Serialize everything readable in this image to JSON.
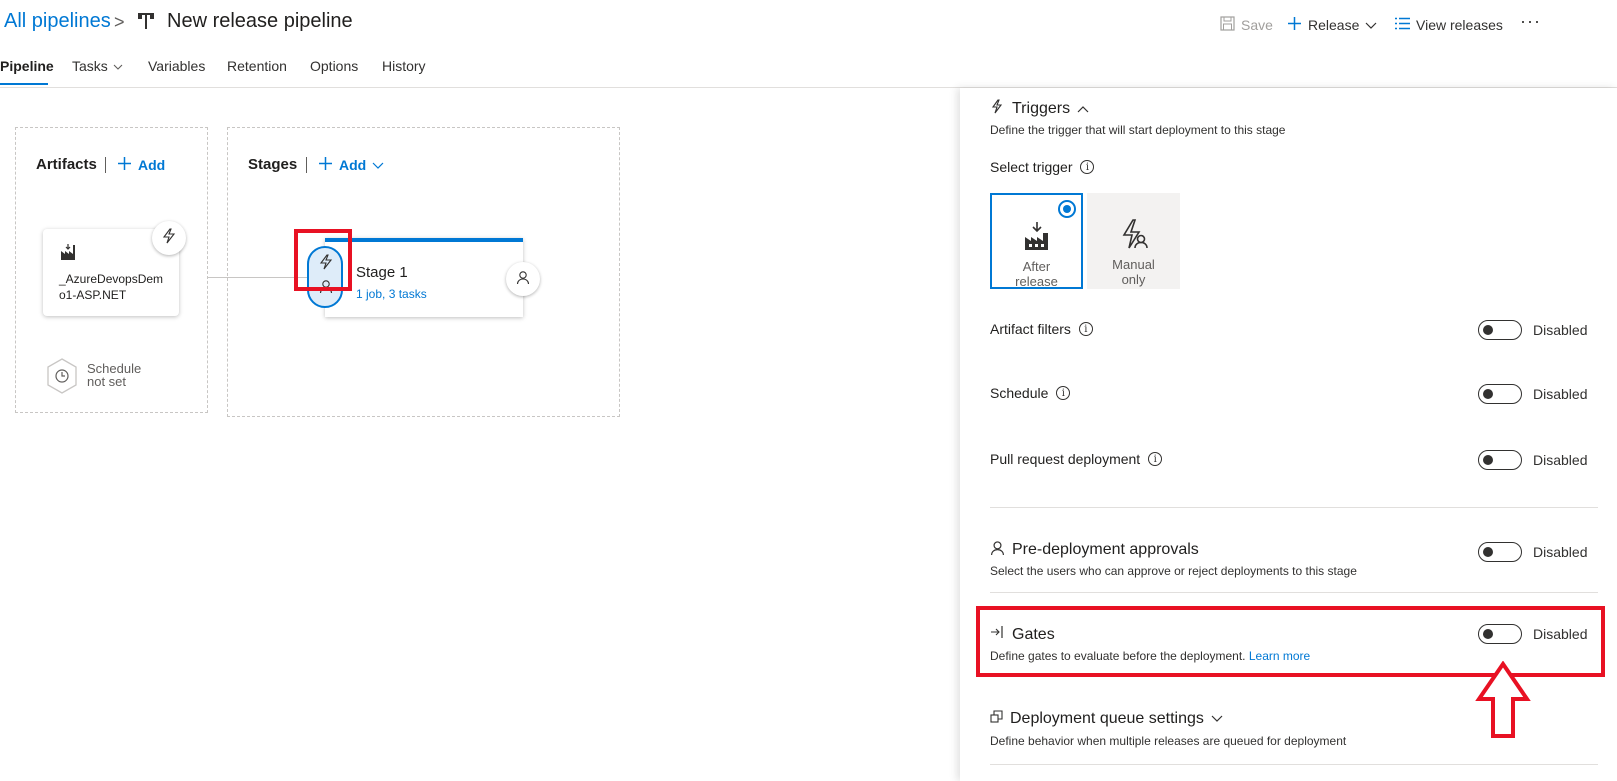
{
  "header": {
    "breadcrumb_link": "All pipelines",
    "breadcrumb_sep": ">",
    "title": "New release pipeline",
    "save_label": "Save",
    "release_label": "Release",
    "view_releases_label": "View releases",
    "more_label": "···"
  },
  "tabs": [
    {
      "label": "Pipeline",
      "active": true
    },
    {
      "label": "Tasks"
    },
    {
      "label": "Variables"
    },
    {
      "label": "Retention"
    },
    {
      "label": "Options"
    },
    {
      "label": "History"
    }
  ],
  "canvas": {
    "artifacts_title": "Artifacts",
    "artifacts_add": "Add",
    "artifact_name": "_AzureDevopsDemo1-ASP.NET",
    "schedule_line1": "Schedule",
    "schedule_line2": "not set",
    "stages_title": "Stages",
    "stages_add": "Add",
    "stage_name": "Stage 1",
    "stage_sub": "1 job, 3 tasks"
  },
  "panel": {
    "triggers_title": "Triggers",
    "triggers_desc": "Define the trigger that will start deployment to this stage",
    "select_trigger_label": "Select trigger",
    "after_release_line1": "After",
    "after_release_line2": "release",
    "manual_only_line1": "Manual",
    "manual_only_line2": "only",
    "rows": [
      {
        "label": "Artifact filters",
        "state": "Disabled"
      },
      {
        "label": "Schedule",
        "state": "Disabled"
      },
      {
        "label": "Pull request deployment",
        "state": "Disabled"
      }
    ],
    "approvals_title": "Pre-deployment approvals",
    "approvals_desc": "Select the users who can approve or reject deployments to this stage",
    "approvals_state": "Disabled",
    "gates_title": "Gates",
    "gates_desc": "Define gates to evaluate before the deployment.",
    "gates_learn_more": "Learn more",
    "gates_state": "Disabled",
    "queue_title": "Deployment queue settings",
    "queue_desc": "Define behavior when multiple releases are queued for deployment"
  },
  "colors": {
    "accent": "#0078d4",
    "highlight": "#e81123"
  }
}
